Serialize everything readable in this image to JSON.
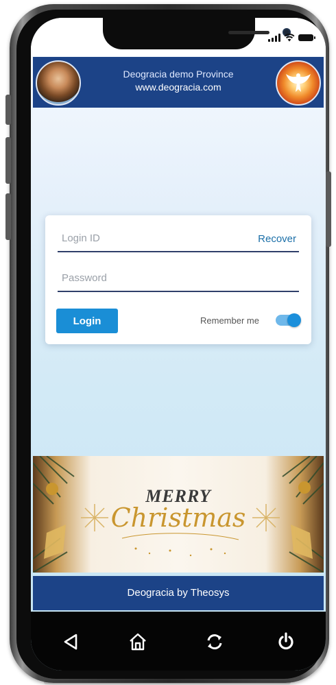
{
  "header": {
    "title": "Deogracia demo Province",
    "url": "www.deogracia.com"
  },
  "login": {
    "login_id_placeholder": "Login ID",
    "recover_label": "Recover",
    "password_placeholder": "Password",
    "login_button": "Login",
    "remember_label": "Remember me",
    "remember_on": true
  },
  "banner": {
    "line1": "MERRY",
    "line2": "Christmas"
  },
  "footer": {
    "text": "Deogracia by Theosys"
  },
  "navbar": {
    "icons": [
      "back-icon",
      "home-icon",
      "refresh-icon",
      "power-icon"
    ]
  },
  "colors": {
    "brand_blue": "#1c4387",
    "button_blue": "#1a8ed6",
    "gold": "#c9962f"
  }
}
